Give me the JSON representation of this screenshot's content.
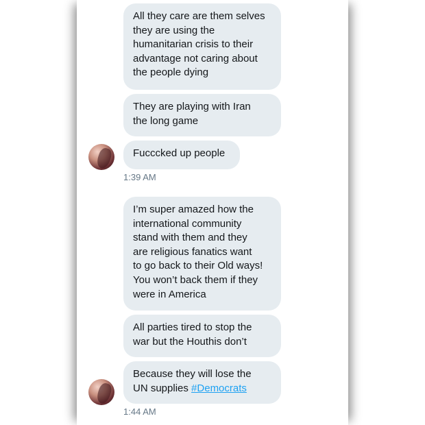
{
  "messages": [
    {
      "text": "All they care are them selves\nthey are using the\nhumanitarian crisis to their\nadvantage not caring about\nthe people dying"
    },
    {
      "text": "They are playing with Iran\nthe long game"
    },
    {
      "text": "Fucccked up people"
    },
    {
      "text": "I’m super amazed how the\ninternational community\nstand with them and they\nare religious fanatics want\nto go back to their Old ways!\nYou won’t back them if they\nwere in America"
    },
    {
      "text": "All parties tired to stop the\nwar but the Houthis don’t"
    },
    {
      "text_prefix": "Because they will lose the\nUN supplies ",
      "hashtag": "#Democrats"
    }
  ],
  "timestamps": [
    "1:39 AM",
    "1:44 AM"
  ],
  "colors": {
    "bubble": "#e6ecf0",
    "text": "#14171a",
    "timestamp": "#657786",
    "hashtag": "#1da1f2"
  }
}
